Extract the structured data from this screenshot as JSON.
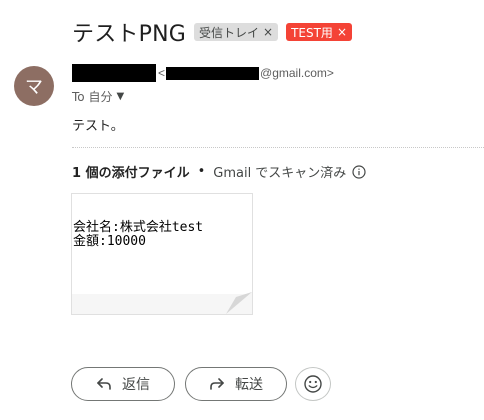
{
  "subject": "テストPNG",
  "labels": [
    {
      "text": "受信トレイ",
      "close": "×"
    },
    {
      "text": "TEST用",
      "close": "×"
    }
  ],
  "avatar_letter": "マ",
  "sender": {
    "email_prefix": "<",
    "email_suffix": "@gmail.com>"
  },
  "to_text": "To 自分",
  "to_caret": "▼",
  "body": "テスト。",
  "attachment_header": {
    "count": "1 個の添付ファイル",
    "separator": "•",
    "scan": "Gmail でスキャン済み"
  },
  "attachment": {
    "line1": "会社名:株式会社test",
    "line2": "金額:10000"
  },
  "actions": {
    "reply": "返信",
    "forward": "転送"
  },
  "icons": [
    "info-icon",
    "reply-arrow-icon",
    "forward-arrow-icon",
    "emoji-icon"
  ]
}
